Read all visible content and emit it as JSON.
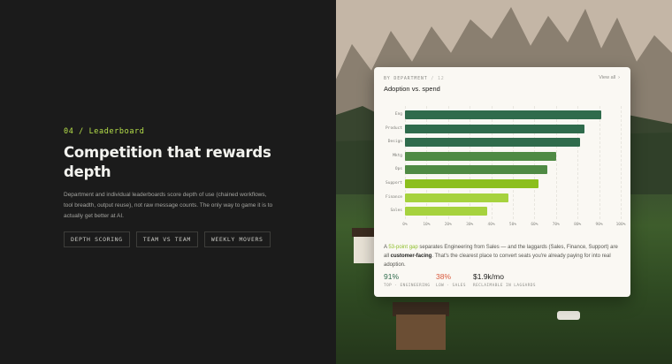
{
  "section": {
    "eyebrow": "04 / Leaderboard",
    "headline": "Competition that rewards depth",
    "description": "Department and individual leaderboards score depth of use (chained workflows, tool breadth, output reuse), not raw message counts. The only way to game it is to actually get better at AI.",
    "tags": [
      "DEPTH SCORING",
      "TEAM VS TEAM",
      "WEEKLY MOVERS"
    ]
  },
  "card": {
    "eyebrow": "BY DEPARTMENT",
    "eyebrow_num": "/ 12",
    "title": "Adoption vs. spend",
    "view_all": "View all",
    "view_all_icon": "chevron-right-icon",
    "insight": {
      "p1": "A ",
      "gap": "53-point gap",
      "p2": " separates Engineering from Sales — and the laggards (Sales, Finance, Support) are all ",
      "bold": "customer-facing",
      "p3": ". That's the clearest place to convert seats you're already paying for into real adoption."
    },
    "stats": [
      {
        "value": "91%",
        "label": "TOP · ENGINEERING",
        "color": "#2f6b4c"
      },
      {
        "value": "38%",
        "label": "LOW · SALES",
        "color": "#d9593c"
      },
      {
        "value": "$1.9k/mo",
        "label": "RECLAIMABLE IN LAGGARDS",
        "color": "#1d1d1b"
      }
    ]
  },
  "chart_data": {
    "type": "bar",
    "orientation": "horizontal",
    "categories": [
      "Eng",
      "Product",
      "Design",
      "Mktg",
      "Ops",
      "Support",
      "Finance",
      "Sales"
    ],
    "values": [
      91,
      83,
      81,
      70,
      66,
      62,
      48,
      38
    ],
    "xlim": [
      0,
      100
    ],
    "xticks": [
      "0%",
      "10%",
      "20%",
      "30%",
      "40%",
      "50%",
      "60%",
      "70%",
      "80%",
      "90%",
      "100%"
    ],
    "colors": [
      "#2f6b4c",
      "#2f6b4c",
      "#2f6b4c",
      "#4f8a44",
      "#4f8a44",
      "#8cbf1e",
      "#a6d23e",
      "#a6d23e"
    ],
    "grid": true
  }
}
